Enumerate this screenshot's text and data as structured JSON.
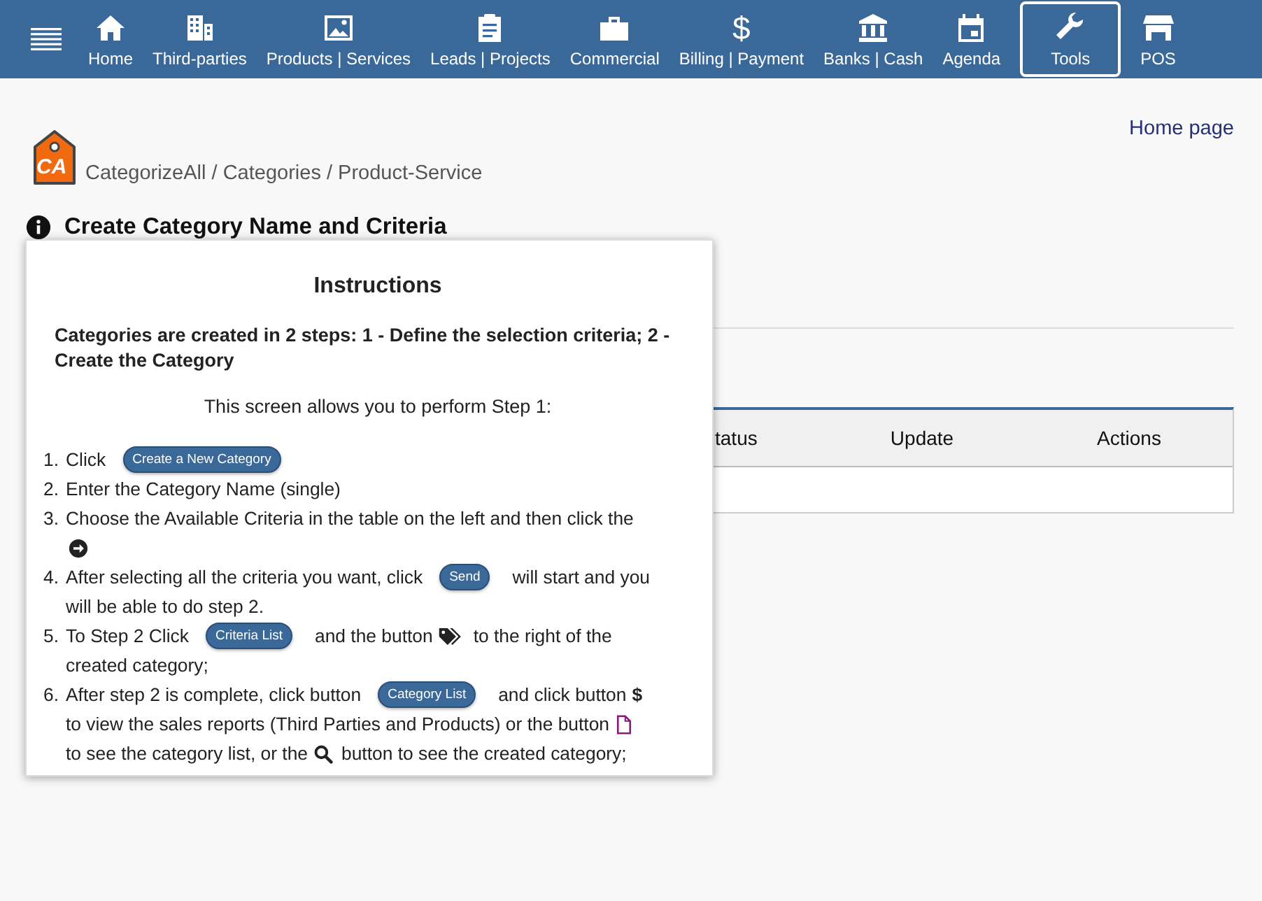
{
  "nav": {
    "items": [
      {
        "label": "Home",
        "selected": false
      },
      {
        "label": "Third-parties",
        "selected": false
      },
      {
        "label": "Products | Services",
        "selected": false
      },
      {
        "label": "Leads | Projects",
        "selected": false
      },
      {
        "label": "Commercial",
        "selected": false
      },
      {
        "label": "Billing | Payment",
        "selected": false,
        "glyph": "$"
      },
      {
        "label": "Banks | Cash",
        "selected": false
      },
      {
        "label": "Agenda",
        "selected": false
      },
      {
        "label": "Tools",
        "selected": true
      },
      {
        "label": "POS",
        "selected": false
      }
    ]
  },
  "header": {
    "logo_text": "CA",
    "breadcrumb": "CategorizeAll / Categories / Product-Service",
    "home_link": "Home page"
  },
  "page_title": "Create Category Name and Criteria",
  "table": {
    "columns": [
      "tatus",
      "Update",
      "Actions"
    ]
  },
  "instructions": {
    "title": "Instructions",
    "intro": "Categories are created in 2 steps: 1 - Define the selection criteria; 2 - Create the Category",
    "subtitle": "This screen allows you to perform Step 1:",
    "steps": [
      {
        "number": "1.",
        "lines": [
          [
            {
              "kind": "text",
              "text": "Click"
            },
            {
              "kind": "button",
              "text": "Create a New Category"
            }
          ]
        ]
      },
      {
        "number": "2.",
        "lines": [
          [
            {
              "kind": "text",
              "text": "Enter the Category Name (single)"
            }
          ]
        ]
      },
      {
        "number": "3.",
        "lines": [
          [
            {
              "kind": "text",
              "text": "Choose the Available Criteria in the table on the left and then click the"
            }
          ],
          [
            {
              "kind": "arrow"
            }
          ]
        ]
      },
      {
        "number": "4.",
        "lines": [
          [
            {
              "kind": "text",
              "text": "After selecting all the criteria you want, click"
            },
            {
              "kind": "button",
              "text": "Send"
            },
            {
              "kind": "text",
              "text": "will start and you"
            }
          ],
          [
            {
              "kind": "text",
              "text": "will be able to do step 2."
            }
          ]
        ]
      },
      {
        "number": "5.",
        "lines": [
          [
            {
              "kind": "text",
              "text": "To Step 2 Click"
            },
            {
              "kind": "button",
              "text": "Criteria List"
            },
            {
              "kind": "text",
              "text": "and the button"
            },
            {
              "kind": "tags"
            },
            {
              "kind": "text",
              "text": "to the right of the"
            }
          ],
          [
            {
              "kind": "text",
              "text": "created category;"
            }
          ]
        ]
      },
      {
        "number": "6.",
        "lines": [
          [
            {
              "kind": "text",
              "text": "After step 2 is complete, click button"
            },
            {
              "kind": "button",
              "text": "Category List"
            },
            {
              "kind": "text",
              "text": "and click button"
            },
            {
              "kind": "glyph",
              "text": "$"
            }
          ],
          [
            {
              "kind": "text",
              "text": "to view the sales reports (Third Parties and Products) or the button"
            },
            {
              "kind": "file"
            }
          ],
          [
            {
              "kind": "text",
              "text": "to see the category list, or the"
            },
            {
              "kind": "search"
            },
            {
              "kind": "text",
              "text": "button to see the created category;"
            }
          ]
        ]
      }
    ]
  }
}
